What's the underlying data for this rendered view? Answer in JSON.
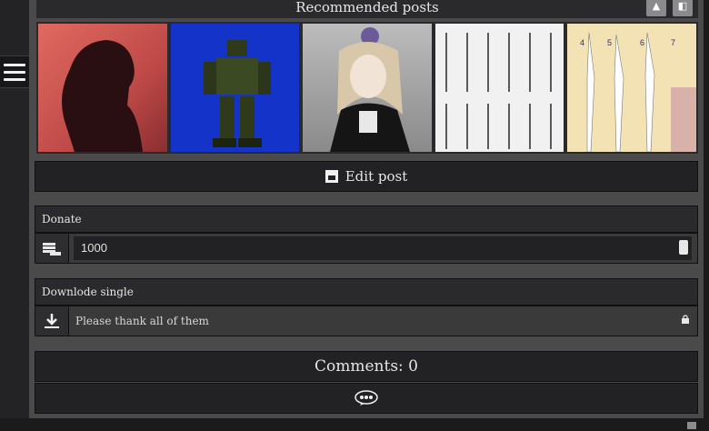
{
  "recommended": {
    "title": "Recommended posts",
    "buttons": [
      {
        "icon": "flame-icon",
        "glyph": "🔥"
      },
      {
        "icon": "toggle-icon",
        "glyph": "◧"
      }
    ],
    "thumbnails": [
      {
        "name": "silhouette-woman"
      },
      {
        "name": "robot-figure"
      },
      {
        "name": "gothic-girl"
      },
      {
        "name": "sword-chart"
      },
      {
        "name": "polearms-chart",
        "labels": [
          "4",
          "5",
          "6",
          "7"
        ]
      }
    ]
  },
  "edit": {
    "label": "Edit post",
    "icon": "download-box-icon"
  },
  "donate": {
    "title": "Donate",
    "value": "1000",
    "icon": "coins-icon"
  },
  "download": {
    "title": "Downlode single",
    "text": "Please thank all of them",
    "icon": "download-arrow-icon"
  },
  "comments": {
    "label": "Comments: 0",
    "icon": "comment-bubble-icon"
  }
}
